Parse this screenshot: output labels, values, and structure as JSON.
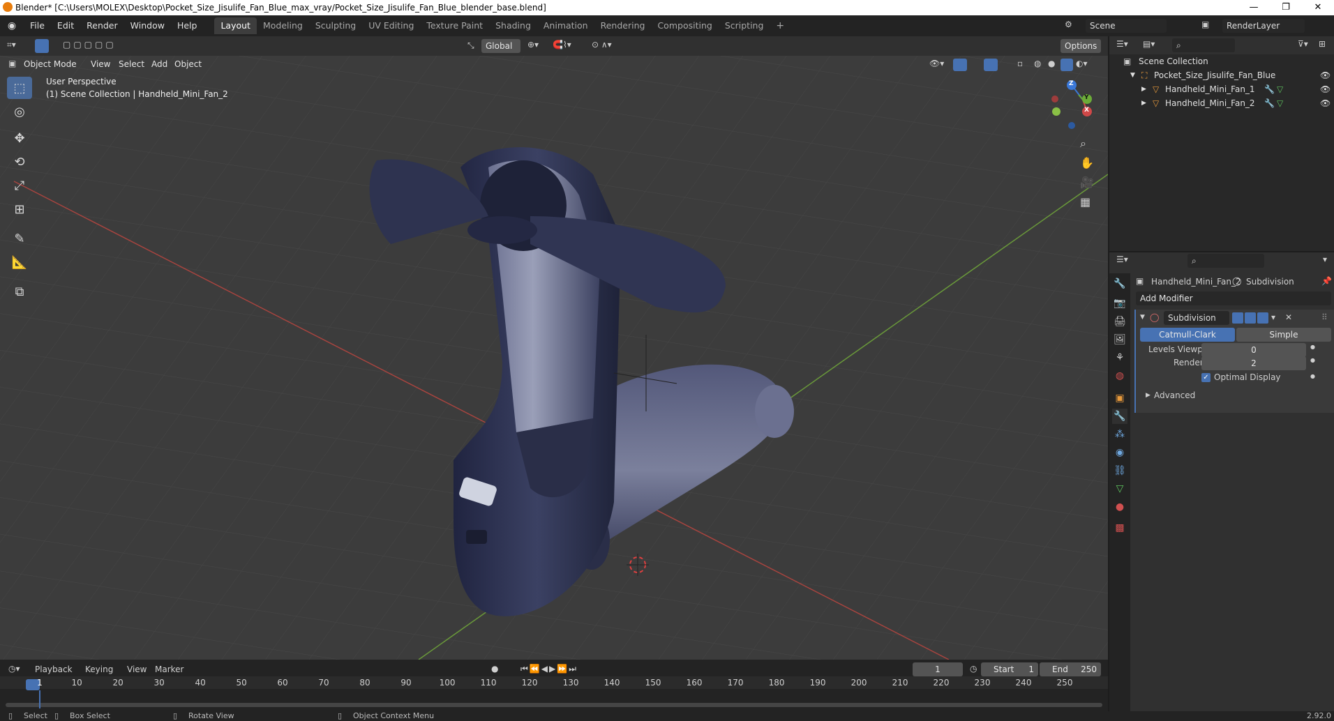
{
  "titlebar": {
    "title": "Blender* [C:\\Users\\MOLEX\\Desktop\\Pocket_Size_Jisulife_Fan_Blue_max_vray/Pocket_Size_Jisulife_Fan_Blue_blender_base.blend]",
    "minimize": "—",
    "maximize": "❐",
    "close": "✕"
  },
  "menu": [
    "File",
    "Edit",
    "Render",
    "Window",
    "Help"
  ],
  "workspaces": [
    "Layout",
    "Modeling",
    "Sculpting",
    "UV Editing",
    "Texture Paint",
    "Shading",
    "Animation",
    "Rendering",
    "Compositing",
    "Scripting"
  ],
  "scene": {
    "name": "Scene",
    "view_layer": "RenderLayer"
  },
  "viewport_header": {
    "mode": "Object Mode",
    "menus": [
      "View",
      "Select",
      "Add",
      "Object"
    ],
    "orientation": "Global",
    "options": "Options"
  },
  "viewport": {
    "perspective": "User Perspective",
    "collection_info": "(1) Scene Collection | Handheld_Mini_Fan_2",
    "gizmo_axes": {
      "z": "Z",
      "y": "Y",
      "x": "X"
    }
  },
  "outliner": {
    "root": "Scene Collection",
    "collection": "Pocket_Size_Jisulife_Fan_Blue",
    "objects": [
      "Handheld_Mini_Fan_1",
      "Handheld_Mini_Fan_2"
    ]
  },
  "properties": {
    "object_name": "Handheld_Mini_Fan_2",
    "modifier_context": "Subdivision",
    "add_modifier": "Add Modifier",
    "modifier_name": "Subdivision",
    "algo_options": [
      "Catmull-Clark",
      "Simple"
    ],
    "algo_selected": "Catmull-Clark",
    "levels_viewport_label": "Levels Viewport",
    "levels_viewport": "0",
    "render_label": "Render",
    "render_levels": "2",
    "optimal_display_label": "Optimal Display",
    "optimal_display": true,
    "advanced_label": "Advanced"
  },
  "timeline": {
    "menus": [
      "Playback",
      "Keying",
      "View",
      "Marker"
    ],
    "current_frame": "1",
    "start_label": "Start",
    "start": "1",
    "end_label": "End",
    "end": "250",
    "ticks": [
      "1",
      "10",
      "20",
      "30",
      "40",
      "50",
      "60",
      "70",
      "80",
      "90",
      "100",
      "110",
      "120",
      "130",
      "140",
      "150",
      "160",
      "170",
      "180",
      "190",
      "200",
      "210",
      "220",
      "230",
      "240",
      "250"
    ]
  },
  "statusbar": {
    "select": "Select",
    "box_select": "Box Select",
    "rotate_view": "Rotate View",
    "context_menu": "Object Context Menu",
    "version": "2.92.0"
  },
  "colors": {
    "accent_blue": "#4772b3",
    "fan_body": "#2e3350",
    "viewport_bg": "#3c3c3c",
    "x_axis": "#c84848",
    "y_axis": "#7fb040"
  }
}
